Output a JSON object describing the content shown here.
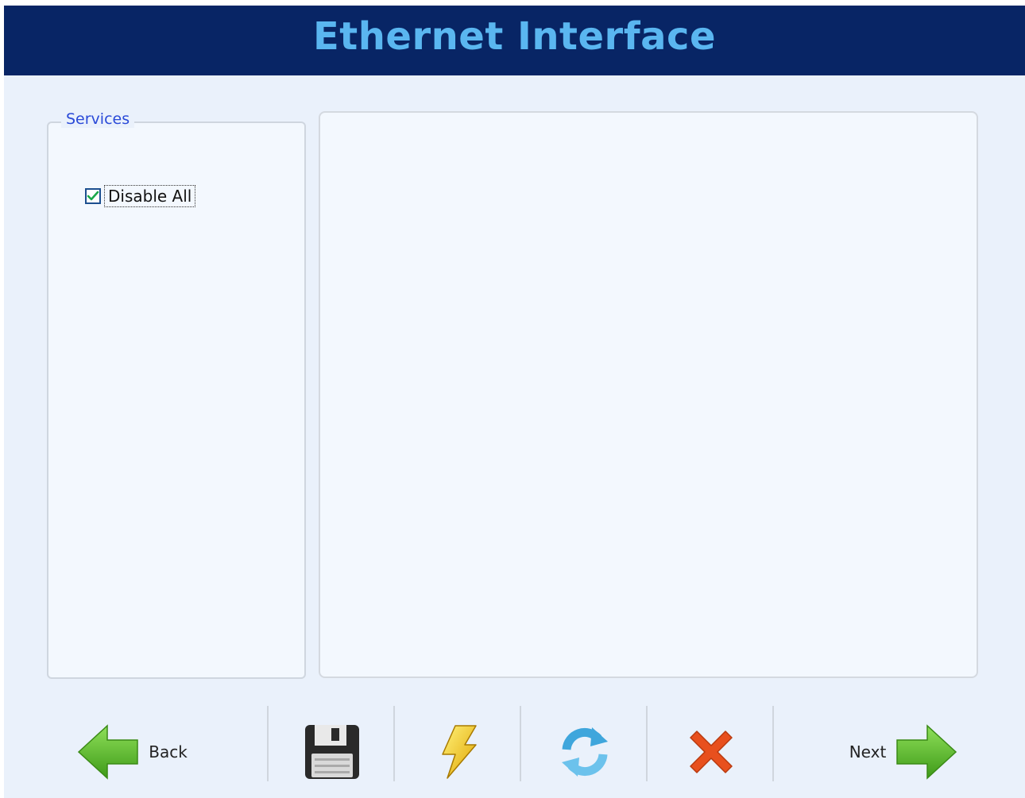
{
  "window": {
    "title": "Ethernet Interface"
  },
  "services": {
    "legend": "Services",
    "disable_all": {
      "label": "Disable All",
      "checked": true
    }
  },
  "toolbar": {
    "back_label": "Back",
    "next_label": "Next",
    "icons": [
      "back-arrow-icon",
      "save-icon",
      "lightning-icon",
      "refresh-icon",
      "cancel-icon",
      "next-arrow-icon"
    ]
  },
  "colors": {
    "title_bar": "#082565",
    "title_text": "#5ab6f0",
    "legend_text": "#2a4ad8",
    "arrow_green": "#5cbf2a",
    "cancel_red": "#e8501e"
  }
}
